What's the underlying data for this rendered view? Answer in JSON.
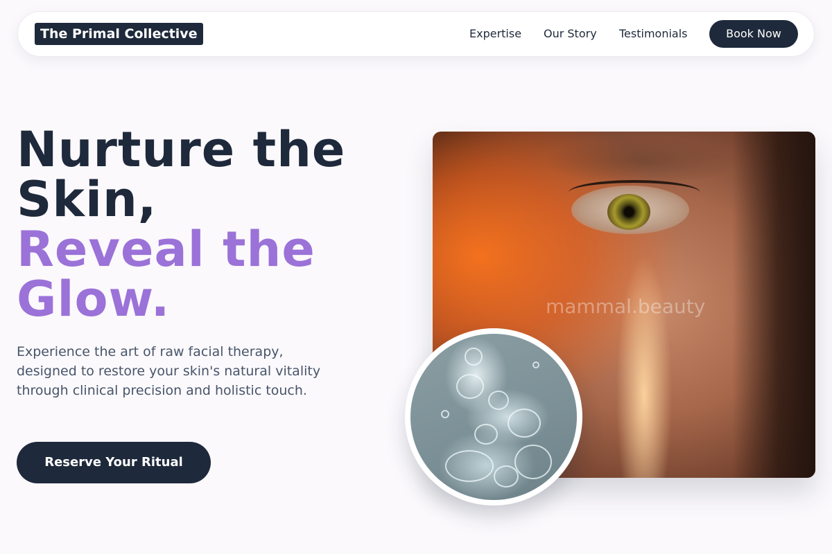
{
  "header": {
    "logo_text": "The Primal Collective",
    "nav_links": [
      "Expertise",
      "Our Story",
      "Testimonials"
    ],
    "book_button": "Book Now"
  },
  "hero": {
    "headline_line1": "Nurture the",
    "headline_line2": "Skin,",
    "headline_accent_line1": "Reveal the",
    "headline_accent_line2": "Glow.",
    "subtext": "Experience the art of raw facial therapy, designed to restore your skin's natural vitality through clinical precision and holistic touch.",
    "cta_button": "Reserve Your Ritual",
    "image_watermark": "mammal.beauty"
  },
  "colors": {
    "primary_dark": "#1e293b",
    "accent_purple": "#9b72d8",
    "body_text": "#475569",
    "page_background": "#fbf9fc"
  }
}
